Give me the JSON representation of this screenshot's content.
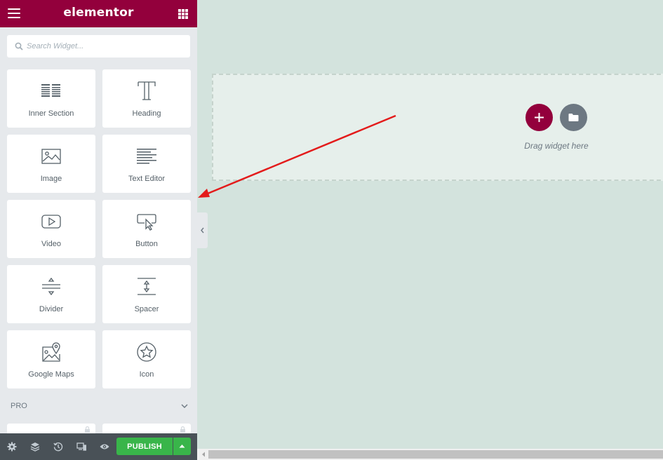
{
  "topbar": {
    "logo": "elementor",
    "menu_icon": "hamburger-menu-icon",
    "apps_icon": "grid-apps-icon",
    "background": "#93003c"
  },
  "search": {
    "placeholder": "Search Widget...",
    "value": ""
  },
  "widgets": [
    {
      "label": "Inner Section",
      "icon": "inner-section-icon"
    },
    {
      "label": "Heading",
      "icon": "heading-icon"
    },
    {
      "label": "Image",
      "icon": "image-icon"
    },
    {
      "label": "Text Editor",
      "icon": "text-editor-icon"
    },
    {
      "label": "Video",
      "icon": "video-icon"
    },
    {
      "label": "Button",
      "icon": "button-icon"
    },
    {
      "label": "Divider",
      "icon": "divider-icon"
    },
    {
      "label": "Spacer",
      "icon": "spacer-icon"
    },
    {
      "label": "Google Maps",
      "icon": "google-maps-icon"
    },
    {
      "label": "Icon",
      "icon": "star-icon"
    }
  ],
  "pro_section": {
    "label": "PRO"
  },
  "bottombar": {
    "publish_label": "PUBLISH",
    "publish_color": "#39b54a"
  },
  "canvas": {
    "drag_text": "Drag widget here",
    "add_color": "#93003c",
    "folder_color": "#6d7882"
  }
}
